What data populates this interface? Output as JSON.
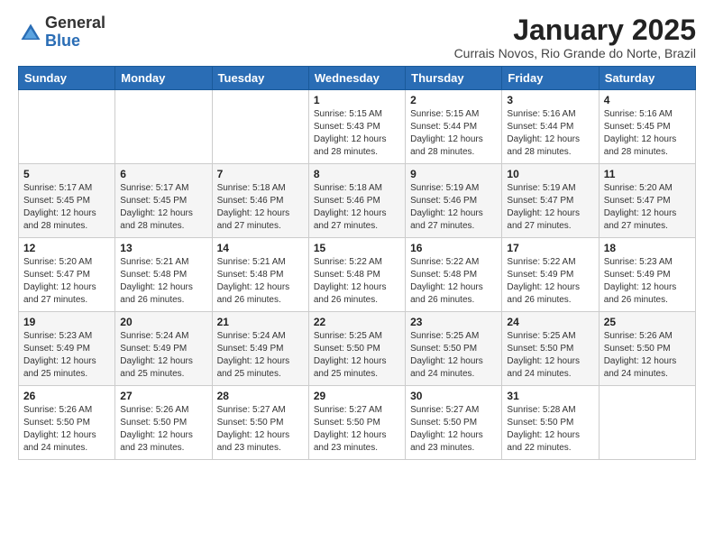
{
  "logo": {
    "general": "General",
    "blue": "Blue"
  },
  "header": {
    "month": "January 2025",
    "location": "Currais Novos, Rio Grande do Norte, Brazil"
  },
  "weekdays": [
    "Sunday",
    "Monday",
    "Tuesday",
    "Wednesday",
    "Thursday",
    "Friday",
    "Saturday"
  ],
  "weeks": [
    [
      {
        "day": "",
        "info": ""
      },
      {
        "day": "",
        "info": ""
      },
      {
        "day": "",
        "info": ""
      },
      {
        "day": "1",
        "info": "Sunrise: 5:15 AM\nSunset: 5:43 PM\nDaylight: 12 hours\nand 28 minutes."
      },
      {
        "day": "2",
        "info": "Sunrise: 5:15 AM\nSunset: 5:44 PM\nDaylight: 12 hours\nand 28 minutes."
      },
      {
        "day": "3",
        "info": "Sunrise: 5:16 AM\nSunset: 5:44 PM\nDaylight: 12 hours\nand 28 minutes."
      },
      {
        "day": "4",
        "info": "Sunrise: 5:16 AM\nSunset: 5:45 PM\nDaylight: 12 hours\nand 28 minutes."
      }
    ],
    [
      {
        "day": "5",
        "info": "Sunrise: 5:17 AM\nSunset: 5:45 PM\nDaylight: 12 hours\nand 28 minutes."
      },
      {
        "day": "6",
        "info": "Sunrise: 5:17 AM\nSunset: 5:45 PM\nDaylight: 12 hours\nand 28 minutes."
      },
      {
        "day": "7",
        "info": "Sunrise: 5:18 AM\nSunset: 5:46 PM\nDaylight: 12 hours\nand 27 minutes."
      },
      {
        "day": "8",
        "info": "Sunrise: 5:18 AM\nSunset: 5:46 PM\nDaylight: 12 hours\nand 27 minutes."
      },
      {
        "day": "9",
        "info": "Sunrise: 5:19 AM\nSunset: 5:46 PM\nDaylight: 12 hours\nand 27 minutes."
      },
      {
        "day": "10",
        "info": "Sunrise: 5:19 AM\nSunset: 5:47 PM\nDaylight: 12 hours\nand 27 minutes."
      },
      {
        "day": "11",
        "info": "Sunrise: 5:20 AM\nSunset: 5:47 PM\nDaylight: 12 hours\nand 27 minutes."
      }
    ],
    [
      {
        "day": "12",
        "info": "Sunrise: 5:20 AM\nSunset: 5:47 PM\nDaylight: 12 hours\nand 27 minutes."
      },
      {
        "day": "13",
        "info": "Sunrise: 5:21 AM\nSunset: 5:48 PM\nDaylight: 12 hours\nand 26 minutes."
      },
      {
        "day": "14",
        "info": "Sunrise: 5:21 AM\nSunset: 5:48 PM\nDaylight: 12 hours\nand 26 minutes."
      },
      {
        "day": "15",
        "info": "Sunrise: 5:22 AM\nSunset: 5:48 PM\nDaylight: 12 hours\nand 26 minutes."
      },
      {
        "day": "16",
        "info": "Sunrise: 5:22 AM\nSunset: 5:48 PM\nDaylight: 12 hours\nand 26 minutes."
      },
      {
        "day": "17",
        "info": "Sunrise: 5:22 AM\nSunset: 5:49 PM\nDaylight: 12 hours\nand 26 minutes."
      },
      {
        "day": "18",
        "info": "Sunrise: 5:23 AM\nSunset: 5:49 PM\nDaylight: 12 hours\nand 26 minutes."
      }
    ],
    [
      {
        "day": "19",
        "info": "Sunrise: 5:23 AM\nSunset: 5:49 PM\nDaylight: 12 hours\nand 25 minutes."
      },
      {
        "day": "20",
        "info": "Sunrise: 5:24 AM\nSunset: 5:49 PM\nDaylight: 12 hours\nand 25 minutes."
      },
      {
        "day": "21",
        "info": "Sunrise: 5:24 AM\nSunset: 5:49 PM\nDaylight: 12 hours\nand 25 minutes."
      },
      {
        "day": "22",
        "info": "Sunrise: 5:25 AM\nSunset: 5:50 PM\nDaylight: 12 hours\nand 25 minutes."
      },
      {
        "day": "23",
        "info": "Sunrise: 5:25 AM\nSunset: 5:50 PM\nDaylight: 12 hours\nand 24 minutes."
      },
      {
        "day": "24",
        "info": "Sunrise: 5:25 AM\nSunset: 5:50 PM\nDaylight: 12 hours\nand 24 minutes."
      },
      {
        "day": "25",
        "info": "Sunrise: 5:26 AM\nSunset: 5:50 PM\nDaylight: 12 hours\nand 24 minutes."
      }
    ],
    [
      {
        "day": "26",
        "info": "Sunrise: 5:26 AM\nSunset: 5:50 PM\nDaylight: 12 hours\nand 24 minutes."
      },
      {
        "day": "27",
        "info": "Sunrise: 5:26 AM\nSunset: 5:50 PM\nDaylight: 12 hours\nand 23 minutes."
      },
      {
        "day": "28",
        "info": "Sunrise: 5:27 AM\nSunset: 5:50 PM\nDaylight: 12 hours\nand 23 minutes."
      },
      {
        "day": "29",
        "info": "Sunrise: 5:27 AM\nSunset: 5:50 PM\nDaylight: 12 hours\nand 23 minutes."
      },
      {
        "day": "30",
        "info": "Sunrise: 5:27 AM\nSunset: 5:50 PM\nDaylight: 12 hours\nand 23 minutes."
      },
      {
        "day": "31",
        "info": "Sunrise: 5:28 AM\nSunset: 5:50 PM\nDaylight: 12 hours\nand 22 minutes."
      },
      {
        "day": "",
        "info": ""
      }
    ]
  ]
}
